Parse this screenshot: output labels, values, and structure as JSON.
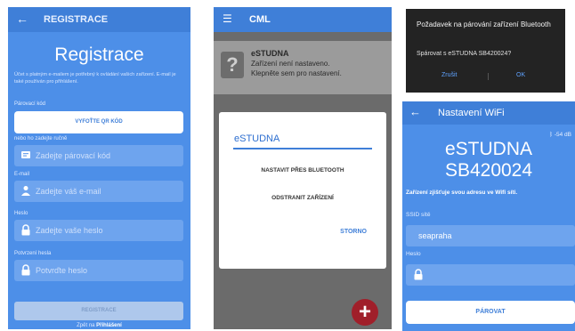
{
  "registration": {
    "back_icon": "arrow-left-icon",
    "toolbar_title": "REGISTRACE",
    "heading": "Registrace",
    "info_text": "Účet s platným e-mailem je potřebný k ovládání vašich zařízení. E-mail je také používán pro přihlášení.",
    "pairing_label": "Párovací kód",
    "qr_button": "VYFOŤTE QR KÓD",
    "or_label": "nebo ho zadejte ručně",
    "pairing_placeholder": "Zadejte párovací kód",
    "email_label": "E-mail",
    "email_placeholder": "Zadejte váš e-mail",
    "password_label": "Heslo",
    "password_placeholder": "Zadejte vaše heslo",
    "confirm_label": "Potvrzení hesla",
    "confirm_placeholder": "Potvrďte heslo",
    "register_button": "REGISTRACE",
    "footer_text": "Zpět na",
    "footer_link": "Přihlášení"
  },
  "device_list": {
    "menu_icon": "hamburger-menu-icon",
    "toolbar_title": "CML",
    "device_name": "eSTUDNA",
    "device_status": "Zařízení není nastaveno.",
    "device_hint": "Klepněte sem pro nastavení.",
    "device_icon": "question-mark-icon",
    "dialog_title": "eSTUDNA",
    "option_bluetooth": "NASTAVIT PŘES BLUETOOTH",
    "option_remove": "ODSTRANIT ZAŘÍZENÍ",
    "cancel_button": "STORNO",
    "fab_icon": "plus-icon"
  },
  "pairing_dialog": {
    "title": "Požadavek na párování zařízení Bluetooth",
    "message": "Spárovat s eSTUDNA SB420024?",
    "cancel_button": "Zrušit",
    "ok_button": "OK"
  },
  "wifi": {
    "back_icon": "arrow-left-icon",
    "toolbar_title": "Nastavení WiFi",
    "signal": "-54 dB",
    "device_line1": "eSTUDNA",
    "device_line2": "SB420024",
    "info_text": "Zařízení zjišťuje svou adresu ve Wifi síti.",
    "ssid_label": "SSID sítě",
    "ssid_value": "seapraha",
    "password_label": "Heslo",
    "pair_button": "PÁROVAT"
  },
  "colors": {
    "accent_blue": "#4d8fe8",
    "toolbar_blue": "#3f7fd8",
    "fab_red": "#a01f2a",
    "dialog_dark": "#232323"
  }
}
